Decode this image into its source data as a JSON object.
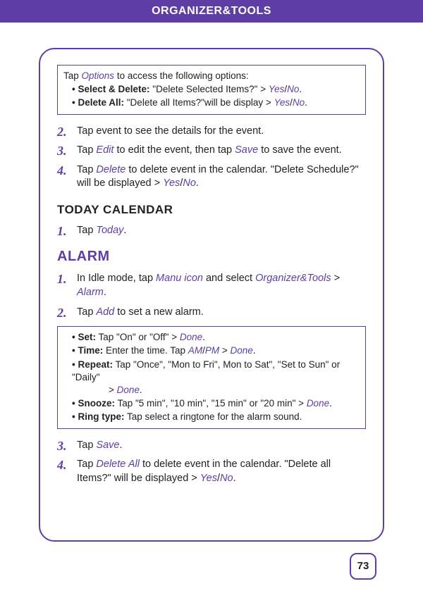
{
  "header": "ORGANIZER&TOOLS",
  "box1": {
    "intro_a": "Tap ",
    "intro_link": "Options",
    "intro_b": " to access the following options:",
    "b1_label": "Select & Delete:",
    "b1_text_a": " \"Delete Selected Items?\" > ",
    "b1_yes": "Yes",
    "b1_slash": "/",
    "b1_no": "No",
    "b1_dot": ".",
    "b2_label": "Delete All:",
    "b2_text_a": " \"Delete all Items?\"will be display > ",
    "b2_yes": "Yes",
    "b2_slash": "/",
    "b2_no": "No",
    "b2_dot": "."
  },
  "steps_a": {
    "n2": "2.",
    "s2": "Tap event to see the details for the event.",
    "n3": "3.",
    "s3_a": "Tap ",
    "s3_edit": "Edit",
    "s3_b": " to edit the event, then tap ",
    "s3_save": "Save",
    "s3_c": " to save the event.",
    "n4": "4.",
    "s4_a": "Tap ",
    "s4_del": "Delete",
    "s4_b": " to delete event in the calendar. \"Delete Schedule?\" will be displayed > ",
    "s4_yes": "Yes",
    "s4_slash": "/",
    "s4_no": "No",
    "s4_dot": "."
  },
  "today": {
    "title": "TODAY CALENDAR",
    "n1": "1.",
    "s1_a": "Tap ",
    "s1_link": "Today",
    "s1_b": "."
  },
  "alarm": {
    "title": "ALARM",
    "n1": "1.",
    "s1_a": "In Idle mode, tap ",
    "s1_manu": "Manu icon",
    "s1_b": " and select ",
    "s1_org": "Organizer&Tools",
    "s1_gt": " > ",
    "s1_alarm": "Alarm",
    "s1_dot": ".",
    "n2": "2.",
    "s2_a": "Tap ",
    "s2_add": "Add",
    "s2_b": " to set a new alarm."
  },
  "box2": {
    "set_lbl": "Set:",
    "set_txt": " Tap \"On\" or \"Off\" > ",
    "set_done": "Done",
    "dot": ".",
    "time_lbl": "Time:",
    "time_a": " Enter the time. Tap ",
    "time_am": "AM",
    "time_slash": "/",
    "time_pm": "PM",
    "time_b": " > ",
    "time_done": "Done",
    "rep_lbl": "Repeat:",
    "rep_a": " Tap \"Once\", \"Mon to Fri\", Mon to Sat\", \"Set to Sun\" or \"Daily\"",
    "rep_b": "> ",
    "rep_done": "Done",
    "sn_lbl": "Snooze:",
    "sn_a": " Tap \"5 min\", \"10 min\", \"15 min\" or \"20 min\" > ",
    "sn_done": "Done",
    "ring_lbl": "Ring type:",
    "ring_a": " Tap select a ringtone for the alarm sound."
  },
  "steps_b": {
    "n3": "3.",
    "s3_a": "Tap ",
    "s3_save": "Save",
    "s3_b": ".",
    "n4": "4.",
    "s4_a": "Tap ",
    "s4_del": "Delete All",
    "s4_b": " to delete event in the calendar. \"Delete all Items?\" will be displayed > ",
    "s4_yes": "Yes",
    "s4_slash": "/",
    "s4_no": "No",
    "s4_dot": "."
  },
  "page_number": "73"
}
